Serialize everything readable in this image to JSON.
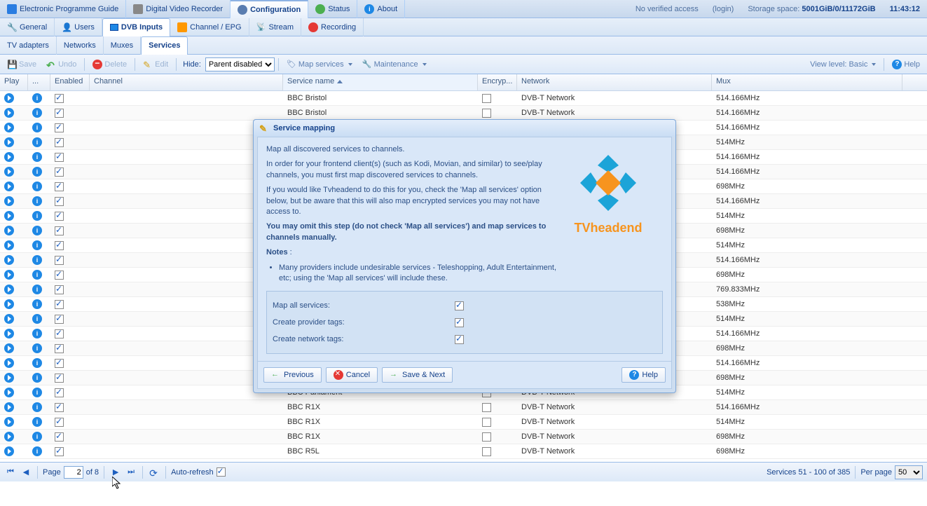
{
  "topbar": {
    "tabs": [
      {
        "label": "Electronic Programme Guide",
        "icon": "epg"
      },
      {
        "label": "Digital Video Recorder",
        "icon": "dvr"
      },
      {
        "label": "Configuration",
        "icon": "config",
        "active": true
      },
      {
        "label": "Status",
        "icon": "status"
      },
      {
        "label": "About",
        "icon": "about"
      }
    ],
    "access": "No verified access",
    "login": "(login)",
    "storage_label": "Storage space:",
    "storage_value": "5001GiB/0/11172GiB",
    "time": "11:43:12"
  },
  "tabs2": [
    {
      "label": "General",
      "icon": "general"
    },
    {
      "label": "Users",
      "icon": "users"
    },
    {
      "label": "DVB Inputs",
      "icon": "dvb",
      "active": true
    },
    {
      "label": "Channel / EPG",
      "icon": "channel"
    },
    {
      "label": "Stream",
      "icon": "stream"
    },
    {
      "label": "Recording",
      "icon": "rec"
    }
  ],
  "tabs3": [
    {
      "label": "TV adapters"
    },
    {
      "label": "Networks"
    },
    {
      "label": "Muxes"
    },
    {
      "label": "Services",
      "active": true
    }
  ],
  "toolbar": {
    "save": "Save",
    "undo": "Undo",
    "delete": "Delete",
    "edit": "Edit",
    "hide_label": "Hide:",
    "hide_value": "Parent disabled",
    "map": "Map services",
    "maintenance": "Maintenance",
    "view_label": "View level:",
    "view_value": "Basic",
    "help": "Help"
  },
  "columns": {
    "play": "Play",
    "details": "...",
    "enabled": "Enabled",
    "channel": "Channel",
    "service": "Service name",
    "encrypted": "Encryp...",
    "network": "Network",
    "mux": "Mux"
  },
  "rows": [
    {
      "service": "BBC Bristol",
      "network": "DVB-T Network",
      "mux": "514.166MHz"
    },
    {
      "service": "BBC Bristol",
      "network": "DVB-T Network",
      "mux": "514.166MHz"
    },
    {
      "service": "",
      "network": "",
      "mux": "514.166MHz"
    },
    {
      "service": "",
      "network": "",
      "mux": "514MHz"
    },
    {
      "service": "",
      "network": "",
      "mux": "514.166MHz"
    },
    {
      "service": "",
      "network": "",
      "mux": "514.166MHz"
    },
    {
      "service": "",
      "network": "",
      "mux": "698MHz"
    },
    {
      "service": "",
      "network": "",
      "mux": "514.166MHz"
    },
    {
      "service": "",
      "network": "",
      "mux": "514MHz"
    },
    {
      "service": "",
      "network": "",
      "mux": "698MHz"
    },
    {
      "service": "",
      "network": "",
      "mux": "514MHz"
    },
    {
      "service": "",
      "network": "",
      "mux": "514.166MHz"
    },
    {
      "service": "",
      "network": "",
      "mux": "698MHz"
    },
    {
      "service": "",
      "network": "",
      "mux": "769.833MHz"
    },
    {
      "service": "",
      "network": "",
      "mux": "538MHz"
    },
    {
      "service": "",
      "network": "",
      "mux": "514MHz"
    },
    {
      "service": "",
      "network": "",
      "mux": "514.166MHz"
    },
    {
      "service": "",
      "network": "",
      "mux": "698MHz"
    },
    {
      "service": "",
      "network": "",
      "mux": "514.166MHz"
    },
    {
      "service": "",
      "network": "",
      "mux": "698MHz"
    },
    {
      "service": "BBC Parliament",
      "network": "DVB-T Network",
      "mux": "514MHz"
    },
    {
      "service": "BBC R1X",
      "network": "DVB-T Network",
      "mux": "514.166MHz"
    },
    {
      "service": "BBC R1X",
      "network": "DVB-T Network",
      "mux": "514MHz"
    },
    {
      "service": "BBC R1X",
      "network": "DVB-T Network",
      "mux": "698MHz"
    },
    {
      "service": "BBC R5L",
      "network": "DVB-T Network",
      "mux": "698MHz"
    }
  ],
  "paging": {
    "page_label": "Page",
    "page": "2",
    "of": "of 8",
    "autorefresh": "Auto-refresh",
    "count": "Services 51 - 100 of 385",
    "perpage_label": "Per page",
    "perpage": "50"
  },
  "dialog": {
    "title": "Service mapping",
    "p1": "Map all discovered services to channels.",
    "p2": "In order for your frontend client(s) (such as Kodi, Movian, and similar) to see/play channels, you must first map discovered services to channels.",
    "p3": "If you would like Tvheadend to do this for you, check the 'Map all services' option below, but be aware that this will also map encrypted services you may not have access to.",
    "p4": "You may omit this step (do not check 'Map all services') and map services to channels manually.",
    "p5": "Notes",
    "li1": "Many providers include undesirable services - Teleshopping, Adult Entertainment, etc; using the 'Map all services' will include these.",
    "logo": "TVheadend",
    "f1": "Map all services:",
    "f2": "Create provider tags:",
    "f3": "Create network tags:",
    "prev": "Previous",
    "cancel": "Cancel",
    "next": "Save & Next",
    "help": "Help"
  }
}
